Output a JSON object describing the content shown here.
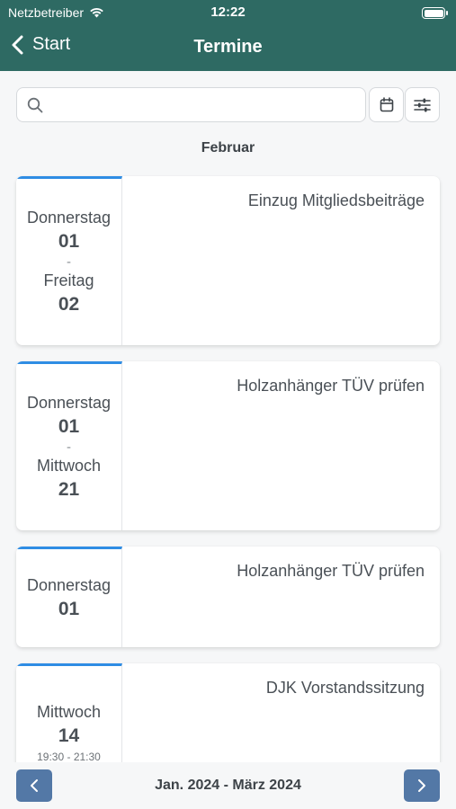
{
  "status": {
    "carrier": "Netzbetreiber",
    "time": "12:22"
  },
  "nav": {
    "back_label": "Start",
    "title": "Termine"
  },
  "search": {
    "placeholder": ""
  },
  "month": "Februar",
  "events": [
    {
      "title": "Einzug Mitgliedsbeiträge",
      "start_weekday": "Donnerstag",
      "start_day": "01",
      "separator": "-",
      "end_weekday": "Freitag",
      "end_day": "02"
    },
    {
      "title": "Holzanhänger TÜV prüfen",
      "start_weekday": "Donnerstag",
      "start_day": "01",
      "separator": "-",
      "end_weekday": "Mittwoch",
      "end_day": "21"
    },
    {
      "title": "Holzanhänger TÜV prüfen",
      "start_weekday": "Donnerstag",
      "start_day": "01"
    },
    {
      "title": "DJK Vorstandssitzung",
      "start_weekday": "Mittwoch",
      "start_day": "14",
      "time": "19:30 - 21:30"
    }
  ],
  "footer": {
    "range": "Jan. 2024 - März 2024"
  },
  "colors": {
    "header": "#2e6a63",
    "accent": "#2f8de4",
    "nav_button": "#5378a6"
  },
  "icons": [
    "chevron-left-icon",
    "search-icon",
    "calendar-icon",
    "sliders-icon",
    "wifi-icon",
    "battery-icon",
    "chevron-right-icon"
  ]
}
